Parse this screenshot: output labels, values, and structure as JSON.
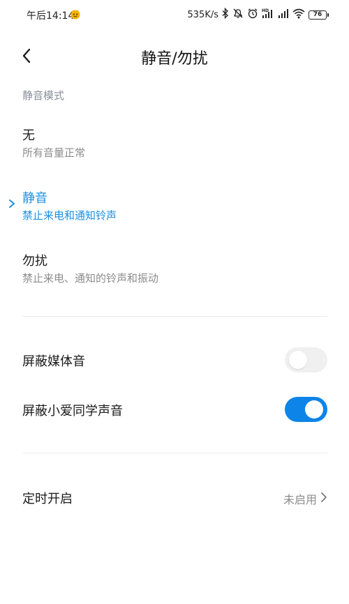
{
  "status_bar": {
    "time": "午后14:14",
    "network_speed": "535K/s",
    "battery_level": "76",
    "icons": [
      "notification-app-icon",
      "bluetooth-icon",
      "mute-icon",
      "alarm-icon",
      "hd-signal-icon",
      "signal-icon",
      "wifi-icon",
      "battery-icon"
    ]
  },
  "header": {
    "title": "静音/勿扰",
    "back_icon": "chevron-left-icon"
  },
  "mode_section": {
    "label": "静音模式",
    "options": [
      {
        "title": "无",
        "subtitle": "所有音量正常",
        "selected": false
      },
      {
        "title": "静音",
        "subtitle": "禁止来电和通知铃声",
        "selected": true
      },
      {
        "title": "勿扰",
        "subtitle": "禁止来电、通知的铃声和振动",
        "selected": false
      }
    ]
  },
  "toggles": [
    {
      "label": "屏蔽媒体音",
      "on": false
    },
    {
      "label": "屏蔽小爱同学声音",
      "on": true
    }
  ],
  "schedule": {
    "label": "定时开启",
    "value": "未启用"
  },
  "colors": {
    "accent": "#1b8fe0",
    "toggle_on": "#0d84e8",
    "secondary_text": "#8c8c8c"
  }
}
